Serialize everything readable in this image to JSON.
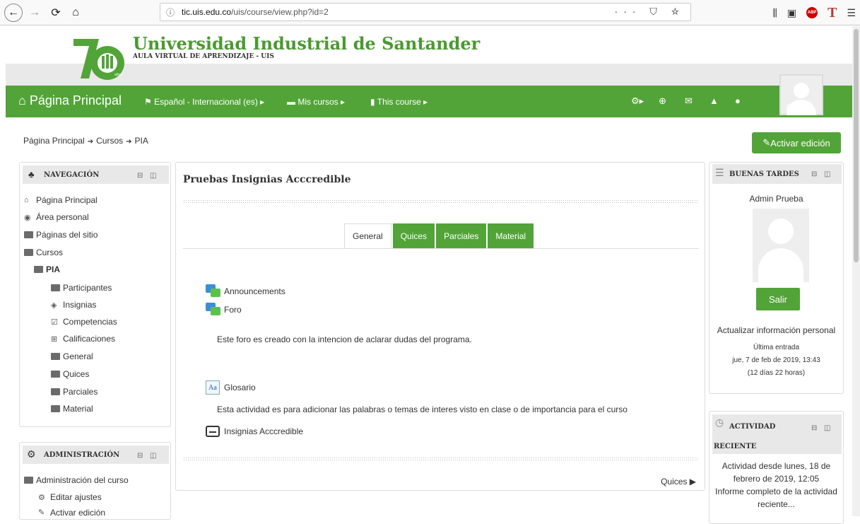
{
  "browser": {
    "url_domain": "tic.uis.edu.co",
    "url_path": "/uis/course/view.php?id=2",
    "url_actions": "··· ⛉ ☆"
  },
  "site": {
    "title": "Universidad Industrial de Santander",
    "subtitle": "AULA VIRTUAL DE APRENDIZAJE - UIS",
    "logo_number": "70",
    "logo_small": "años"
  },
  "navbar": {
    "home": "Página Principal",
    "language": "Español - Internacional (es) ▸",
    "my_courses": "Mis cursos ▸",
    "this_course": "This course ▸",
    "admin": "Admin ▸"
  },
  "breadcrumb": {
    "items": [
      "Página Principal",
      "Cursos",
      "PIA"
    ]
  },
  "edit_button": "Activar edición",
  "navigation_block": {
    "title": "NAVEGACIÓN",
    "items": [
      {
        "label": "Página Principal"
      },
      {
        "label": "Área personal"
      },
      {
        "label": "Páginas del sitio"
      },
      {
        "label": "Cursos"
      },
      {
        "label": "PIA"
      },
      {
        "label": "Participantes"
      },
      {
        "label": "Insignias"
      },
      {
        "label": "Competencias"
      },
      {
        "label": "Calificaciones"
      },
      {
        "label": "General"
      },
      {
        "label": "Quices"
      },
      {
        "label": "Parciales"
      },
      {
        "label": "Material"
      }
    ]
  },
  "admin_block": {
    "title": "ADMINISTRACIÓN",
    "items": [
      {
        "label": "Administración del curso"
      },
      {
        "label": "Editar ajustes"
      },
      {
        "label": "Activar edición"
      }
    ]
  },
  "main": {
    "title": "Pruebas Insignias Acccredible",
    "tabs": [
      "General",
      "Quices",
      "Parciales",
      "Material"
    ],
    "activities": {
      "announcements": "Announcements",
      "foro": "Foro",
      "foro_desc": "Este foro es creado con la intencion de aclarar dudas del programa.",
      "glosario": "Glosario",
      "glosario_desc": "Esta actividad es para adicionar las palabras o temas de interes visto en clase o de importancia para el curso",
      "insignias": "Insignias Acccredible"
    },
    "next_link": "Quices ▶"
  },
  "greeting_block": {
    "title": "BUENAS TARDES",
    "user_name": "Admin Prueba",
    "logout": "Salir",
    "update_profile": "Actualizar información personal",
    "last_access_label": "Última entrada",
    "last_access_date": "jue, 7 de feb de 2019, 13:43",
    "last_access_ago": "(12 días 22 horas)"
  },
  "recent_block": {
    "title_line1": "ACTIVIDAD",
    "title_line2": "RECIENTE",
    "since_line1": "Actividad desde lunes, 18 de",
    "since_line2": "febrero de 2019, 12:05",
    "report_line1": "Informe completo de la actividad",
    "report_line2": "reciente..."
  }
}
